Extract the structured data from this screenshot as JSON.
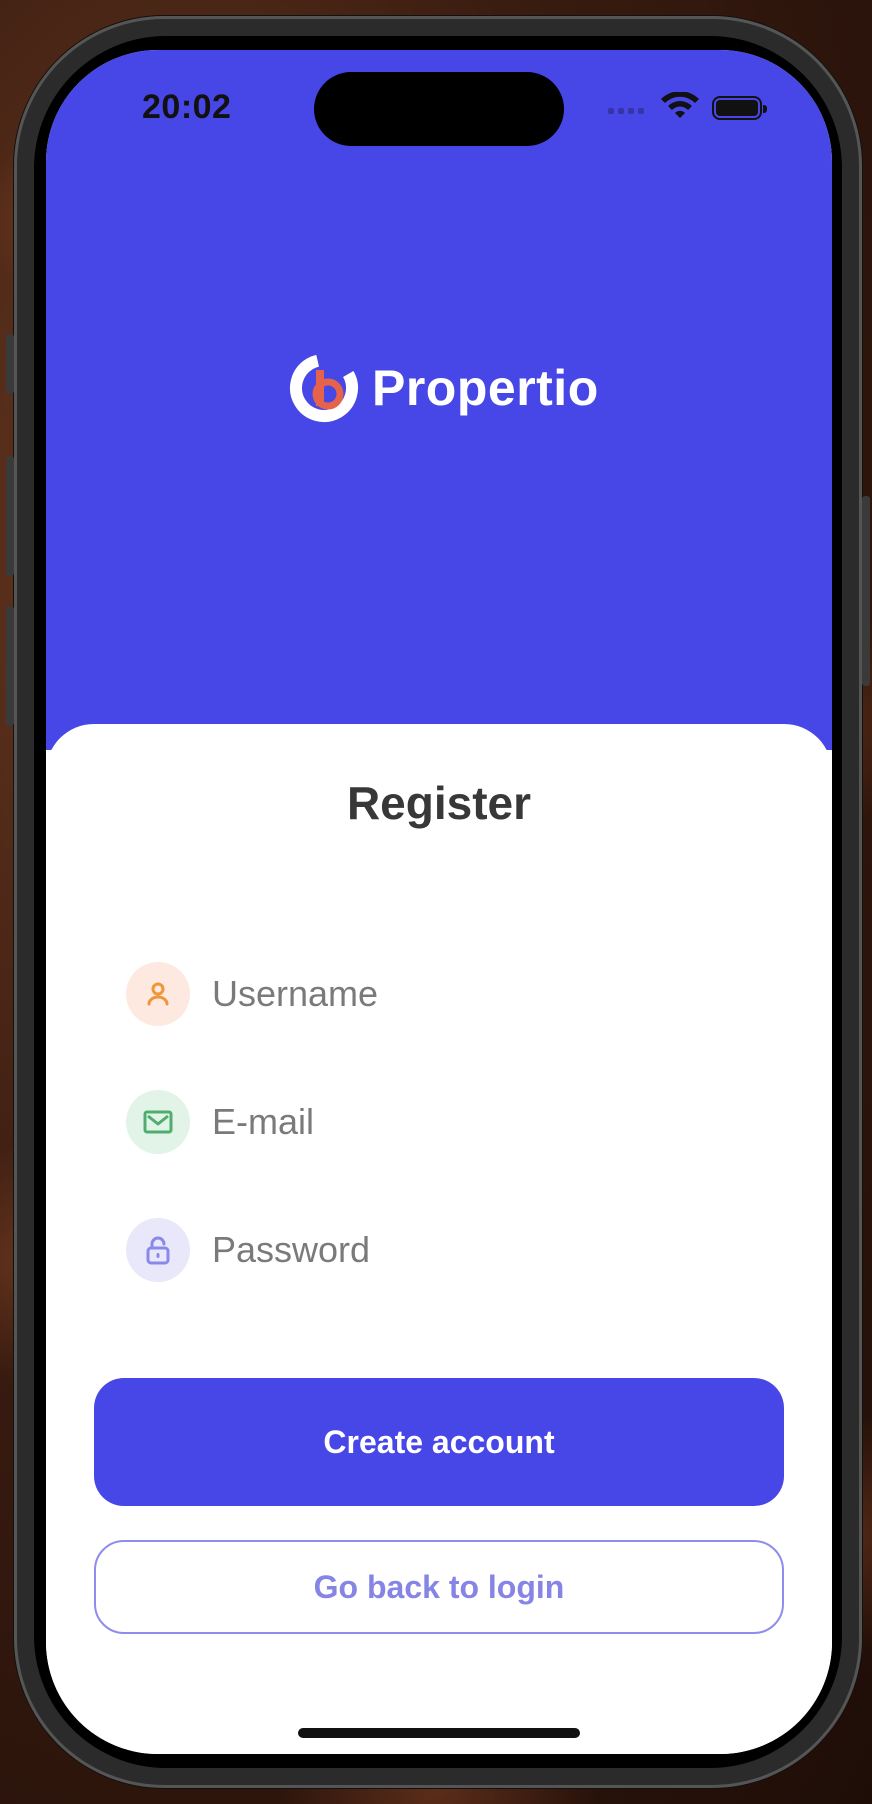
{
  "status_bar": {
    "time": "20:02"
  },
  "brand": {
    "name": "Propertio",
    "primary_color": "#4746e6",
    "logo_accent": "#e5634a"
  },
  "form": {
    "title": "Register",
    "fields": [
      {
        "icon": "user-icon",
        "placeholder": "Username",
        "icon_color": "#f0963a",
        "icon_bg": "#fde9e0"
      },
      {
        "icon": "mail-icon",
        "placeholder": "E-mail",
        "icon_color": "#4fae6e",
        "icon_bg": "#e2f4e8"
      },
      {
        "icon": "lock-icon",
        "placeholder": "Password",
        "icon_color": "#8a88e8",
        "icon_bg": "#e9e8fb"
      }
    ]
  },
  "actions": {
    "create_label": "Create account",
    "back_label": "Go back to login"
  }
}
